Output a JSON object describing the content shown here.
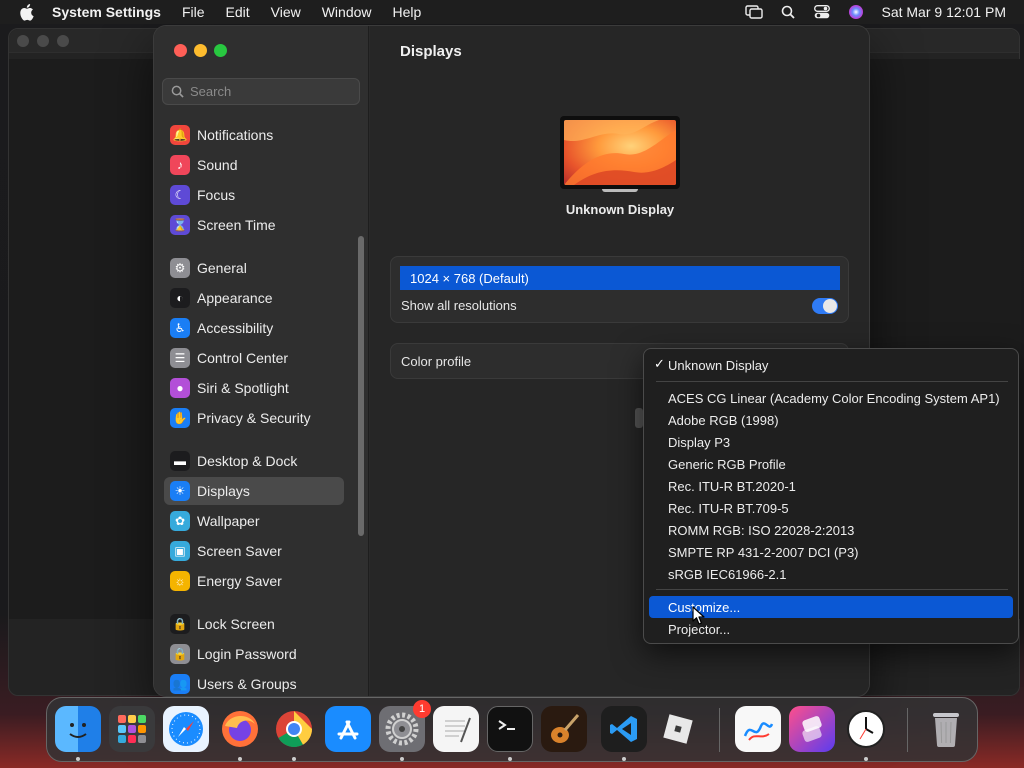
{
  "menubar": {
    "app_name": "System Settings",
    "menus": [
      "File",
      "Edit",
      "View",
      "Window",
      "Help"
    ],
    "clock": "Sat Mar 9  12:01 PM"
  },
  "search": {
    "placeholder": "Search"
  },
  "sidebar": {
    "items": [
      {
        "label": "Notifications",
        "icon": "bell-icon",
        "color": "#f0463c"
      },
      {
        "label": "Sound",
        "icon": "speaker-icon",
        "color": "#f0465a"
      },
      {
        "label": "Focus",
        "icon": "moon-icon",
        "color": "#5e4ad6"
      },
      {
        "label": "Screen Time",
        "icon": "hourglass-icon",
        "color": "#5e4ad6"
      },
      {
        "label": "General",
        "icon": "gear-icon",
        "color": "#8e8e93"
      },
      {
        "label": "Appearance",
        "icon": "appearance-icon",
        "color": "#1c1c1e"
      },
      {
        "label": "Accessibility",
        "icon": "accessibility-icon",
        "color": "#1a7ef5"
      },
      {
        "label": "Control Center",
        "icon": "control-center-icon",
        "color": "#8e8e93"
      },
      {
        "label": "Siri & Spotlight",
        "icon": "siri-icon",
        "color": "#b34fd8"
      },
      {
        "label": "Privacy & Security",
        "icon": "hand-icon",
        "color": "#1a7ef5"
      },
      {
        "label": "Desktop & Dock",
        "icon": "dock-icon",
        "color": "#1c1c1e"
      },
      {
        "label": "Displays",
        "icon": "sun-icon",
        "color": "#1a7ef5",
        "selected": true
      },
      {
        "label": "Wallpaper",
        "icon": "flower-icon",
        "color": "#36aadc"
      },
      {
        "label": "Screen Saver",
        "icon": "screensaver-icon",
        "color": "#36aadc"
      },
      {
        "label": "Energy Saver",
        "icon": "bulb-icon",
        "color": "#f5b400"
      },
      {
        "label": "Lock Screen",
        "icon": "lock-icon",
        "color": "#1c1c1e"
      },
      {
        "label": "Login Password",
        "icon": "lock-icon",
        "color": "#8e8e93"
      },
      {
        "label": "Users & Groups",
        "icon": "users-icon",
        "color": "#1a7ef5"
      }
    ]
  },
  "content": {
    "title": "Displays",
    "display_name": "Unknown Display",
    "resolution": "1024 × 768 (Default)",
    "show_all_label": "Show all resolutions",
    "show_all_on": true,
    "color_profile_label": "Color profile"
  },
  "dropdown": {
    "checked_item": "Unknown Display",
    "items": [
      "ACES CG Linear (Academy Color Encoding System AP1)",
      "Adobe RGB (1998)",
      "Display P3",
      "Generic RGB Profile",
      "Rec. ITU-R BT.2020-1",
      "Rec. ITU-R BT.709-5",
      "ROMM RGB: ISO 22028-2:2013",
      "SMPTE RP 431-2-2007 DCI (P3)",
      "sRGB IEC61966-2.1"
    ],
    "actions": [
      "Customize...",
      "Projector..."
    ],
    "highlighted": "Customize..."
  },
  "dock": {
    "apps": [
      "Finder",
      "Launchpad",
      "Safari",
      "Firefox",
      "Chrome",
      "App Store",
      "System Settings",
      "TextEdit",
      "Terminal",
      "GarageBand",
      "VS Code",
      "Roblox",
      "Freeform",
      "Shortcuts",
      "Clock",
      "Trash"
    ],
    "settings_badge": "1"
  }
}
